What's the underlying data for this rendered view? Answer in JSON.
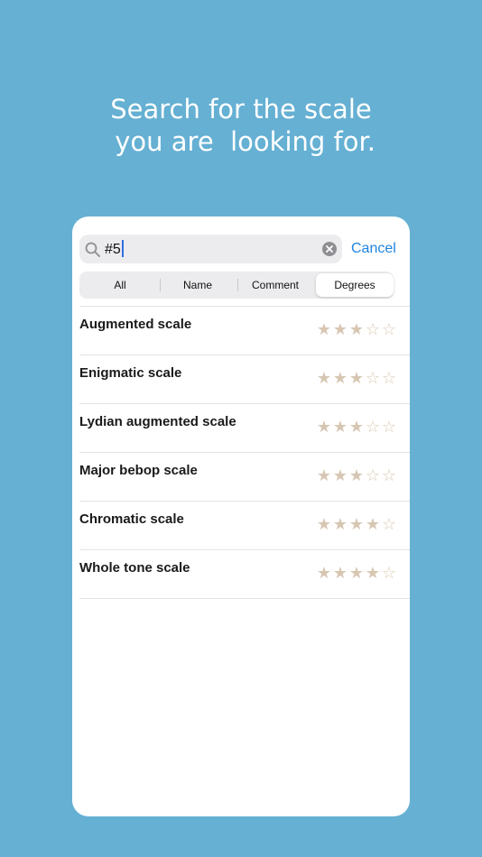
{
  "headline": {
    "line1": "Search for the scale",
    "line2": " you are  looking for."
  },
  "search": {
    "value": "#5",
    "cancel_label": "Cancel"
  },
  "filter_segments": [
    {
      "label": "All",
      "selected": false
    },
    {
      "label": "Name",
      "selected": false
    },
    {
      "label": "Comment",
      "selected": false
    },
    {
      "label": "Degrees",
      "selected": true
    }
  ],
  "results": [
    {
      "name": "Augmented scale",
      "rating": 3,
      "max_rating": 5
    },
    {
      "name": "Enigmatic scale",
      "rating": 3,
      "max_rating": 5
    },
    {
      "name": "Lydian augmented scale",
      "rating": 3,
      "max_rating": 5
    },
    {
      "name": "Major bebop scale",
      "rating": 3,
      "max_rating": 5
    },
    {
      "name": "Chromatic scale",
      "rating": 4,
      "max_rating": 5
    },
    {
      "name": "Whole tone scale",
      "rating": 4,
      "max_rating": 5
    }
  ],
  "colors": {
    "background": "#65b0d3",
    "accent": "#1d84e0",
    "star": "#d7c6b2"
  },
  "icons": {
    "search": "magnifying-glass",
    "clear": "x-circle",
    "star_filled": "★",
    "star_empty": "☆"
  }
}
